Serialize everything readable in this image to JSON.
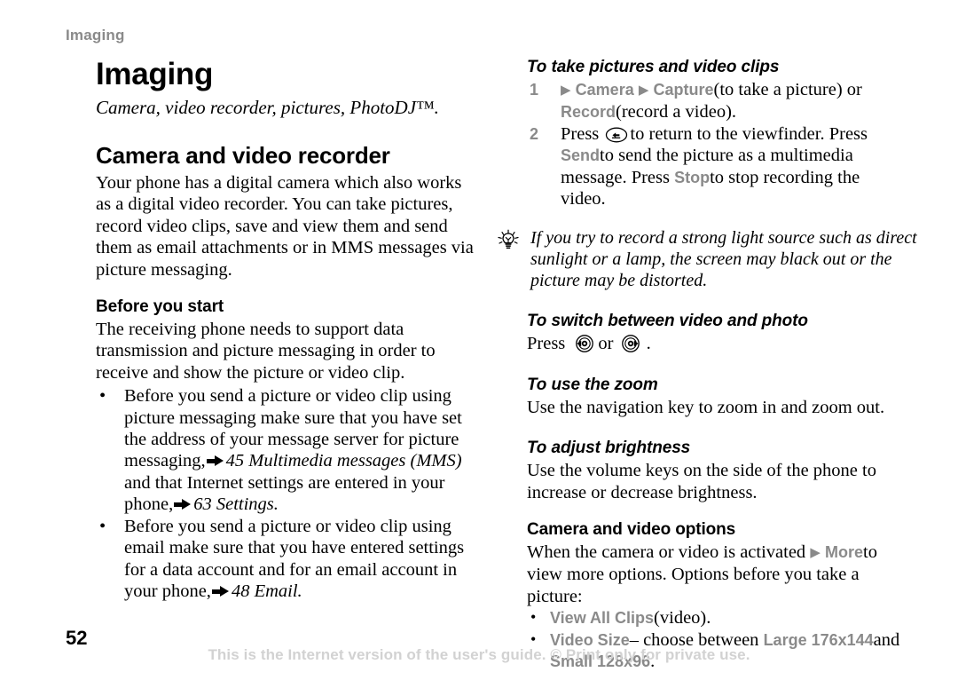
{
  "document": {
    "running_header": "Imaging",
    "page_number": "52",
    "footer_note": "This is the Internet version of the user's guide. © Print only for private use.",
    "colors": {
      "ui_term_gray": "#8a8a8a",
      "header_gray": "#8a8a8a",
      "footer_gray": "#d2d2d2",
      "text_black": "#000000",
      "page_background": "#ffffff"
    }
  },
  "left_column": {
    "chapter_title": "Imaging",
    "chapter_subtitle": "Camera, video recorder, pictures, PhotoDJ™.",
    "section_title": "Camera and video recorder",
    "section_intro": "Your phone has a digital camera which also works as a digital video recorder. You can take pictures, record video clips, save and view them and send them as email attachments or in MMS messages via picture messaging.",
    "before_you_start": {
      "title": "Before you start",
      "intro": "The receiving phone needs to support data transmission and picture messaging in order to receive and show the picture or video clip.",
      "bullets": [
        {
          "text_before": "Before you send a picture or video clip using picture messaging make sure that you have set the address of your message server for picture messaging,",
          "xref_1": "45 Multimedia messages (MMS)",
          "text_middle": "and that Internet settings are entered in your phone,",
          "xref_2": "63 Settings.",
          "bullet_char": "•"
        },
        {
          "text_before": "Before you send a picture or video clip using email make sure that you have entered settings for a data account and for an email account in your phone,",
          "xref_1": "48 Email.",
          "bullet_char": "•"
        }
      ]
    }
  },
  "right_column": {
    "take_pictures": {
      "title": "To take pictures and video clips",
      "steps": [
        {
          "number": "1",
          "ui_camera": "Camera",
          "ui_capture": "Capture",
          "text_after_capture": "(to take a picture) or",
          "ui_record": "Record",
          "text_after_record": "(record a video)."
        },
        {
          "number": "2",
          "text_press": "Press",
          "text_after_key": "to return to the viewfinder. Press",
          "ui_send": "Send",
          "text_after_send": "to send the picture as a multimedia message. Press",
          "ui_stop": "Stop",
          "text_end": "to stop recording the video."
        }
      ]
    },
    "tip": {
      "icon": "lightbulb-icon",
      "text": "If you try to record a strong light source such as direct sunlight or a lamp, the screen may black out or the picture may be distorted."
    },
    "switch_video_photo": {
      "title": "To switch between video and photo",
      "text_press": "Press",
      "text_or": "or",
      "text_end": ".",
      "key_left": "navigation-key-left",
      "key_right": "navigation-key-right"
    },
    "use_zoom": {
      "title": "To use the zoom",
      "text": "Use the navigation key to zoom in and zoom out."
    },
    "adjust_brightness": {
      "title": "To adjust brightness",
      "text": "Use the volume keys on the side of the phone to increase or decrease brightness."
    },
    "camera_video_options": {
      "title": "Camera and video options",
      "intro_before": "When the camera or video is activated",
      "ui_more": "More",
      "intro_after": "to view more options. Options before you take a picture:",
      "bullets": [
        {
          "bullet_char": "•",
          "ui_term": "View All Clips",
          "plain_text": "(video)."
        },
        {
          "bullet_char": "•",
          "ui_term": "Video Size",
          "plain_text": "– choose between",
          "ui_term_2": "Large 176x144",
          "plain_text_2": "and",
          "ui_term_3": "Small 128x96",
          "plain_text_3": "."
        }
      ]
    }
  }
}
